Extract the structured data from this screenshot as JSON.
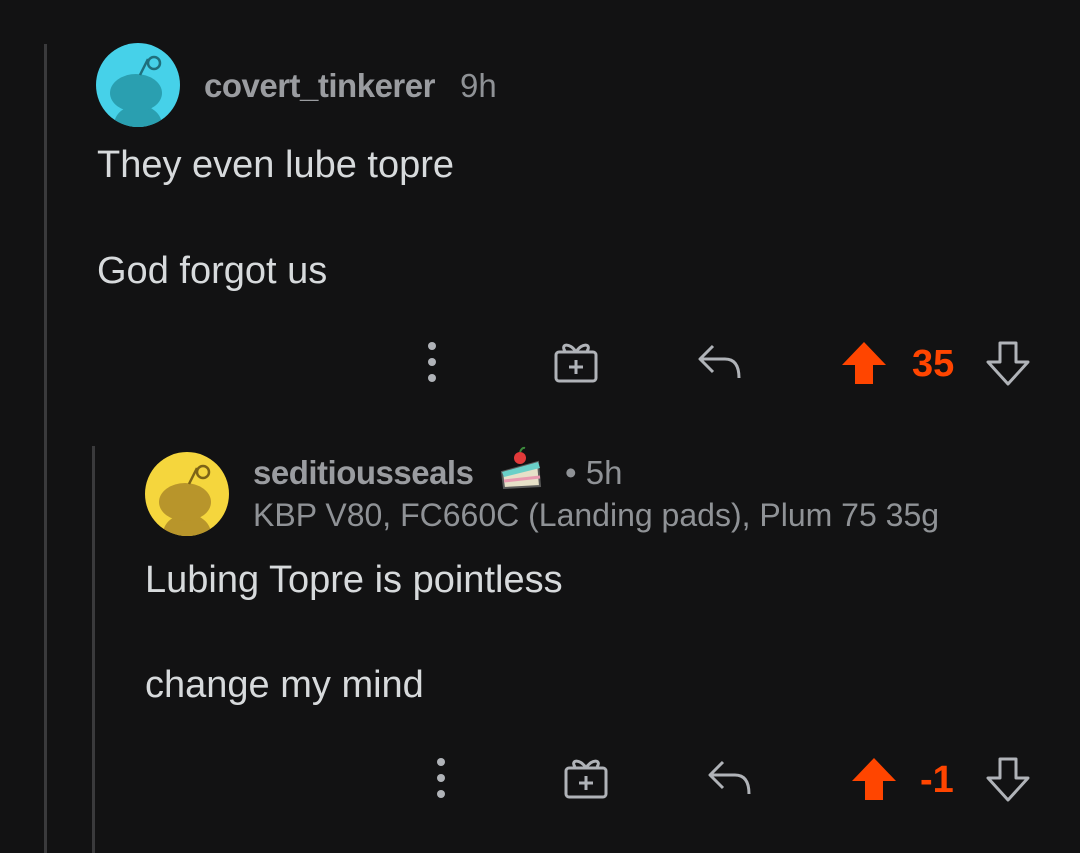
{
  "comments": [
    {
      "username": "covert_tinkerer",
      "age": "9h",
      "avatar_color": "#46d1e9",
      "paragraphs": [
        "They even lube topre",
        "God forgot us"
      ],
      "score": "35",
      "score_color": "#ff4500",
      "upvoted": true
    },
    {
      "username": "seditiousseals",
      "award_icon": "cake-day-icon",
      "age": "• 5h",
      "flair": "KBP V80, FC660C (Landing pads), Plum 75 35g",
      "avatar_color": "#f5d63d",
      "paragraphs": [
        "Lubing Topre is pointless",
        "change my mind"
      ],
      "score": "-1",
      "score_color": "#ff4500",
      "upvoted": true
    }
  ],
  "icons": {
    "more": "more-vertical-icon",
    "gift": "gift-award-icon",
    "reply": "reply-icon",
    "upvote": "upvote-arrow-icon",
    "downvote": "downvote-arrow-icon"
  },
  "colors": {
    "background": "#121213",
    "upvote": "#ff4500",
    "icon": "#b0b3b8"
  }
}
